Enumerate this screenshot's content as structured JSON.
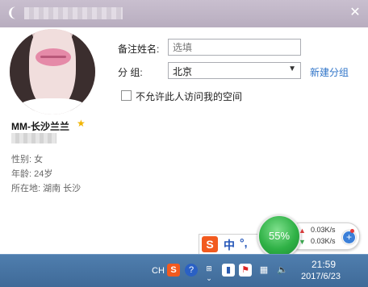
{
  "window": {
    "title": "",
    "close_glyph": "✕",
    "logo_glyph": "❨"
  },
  "profile": {
    "nickname": "MM-长沙兰兰",
    "gender": "性别: 女",
    "age": "年龄: 24岁",
    "location": "所在地: 湖南  长沙"
  },
  "form": {
    "remark_label": "备注姓名:",
    "remark_placeholder": "选填",
    "group_label": "分      组:",
    "group_value": "北京",
    "new_group_link": "新建分组",
    "privacy_checkbox_label": "不允许此人访问我的空间",
    "privacy_checked": false
  },
  "net_monitor": {
    "percent": "55%",
    "upload": "0.03K/s",
    "download": "0.03K/s",
    "boost_glyph": "+"
  },
  "ime": {
    "logo": "S",
    "mode": "中",
    "punct": "°,"
  },
  "taskbar": {
    "lang": "CH",
    "time": "21:59",
    "date": "2017/6/23"
  },
  "colors": {
    "titlebar": "#c0b5c7",
    "link": "#2f74c8",
    "taskbar": "#4674a4",
    "net_ball": "#2fb146",
    "sogou": "#f25a1f"
  }
}
